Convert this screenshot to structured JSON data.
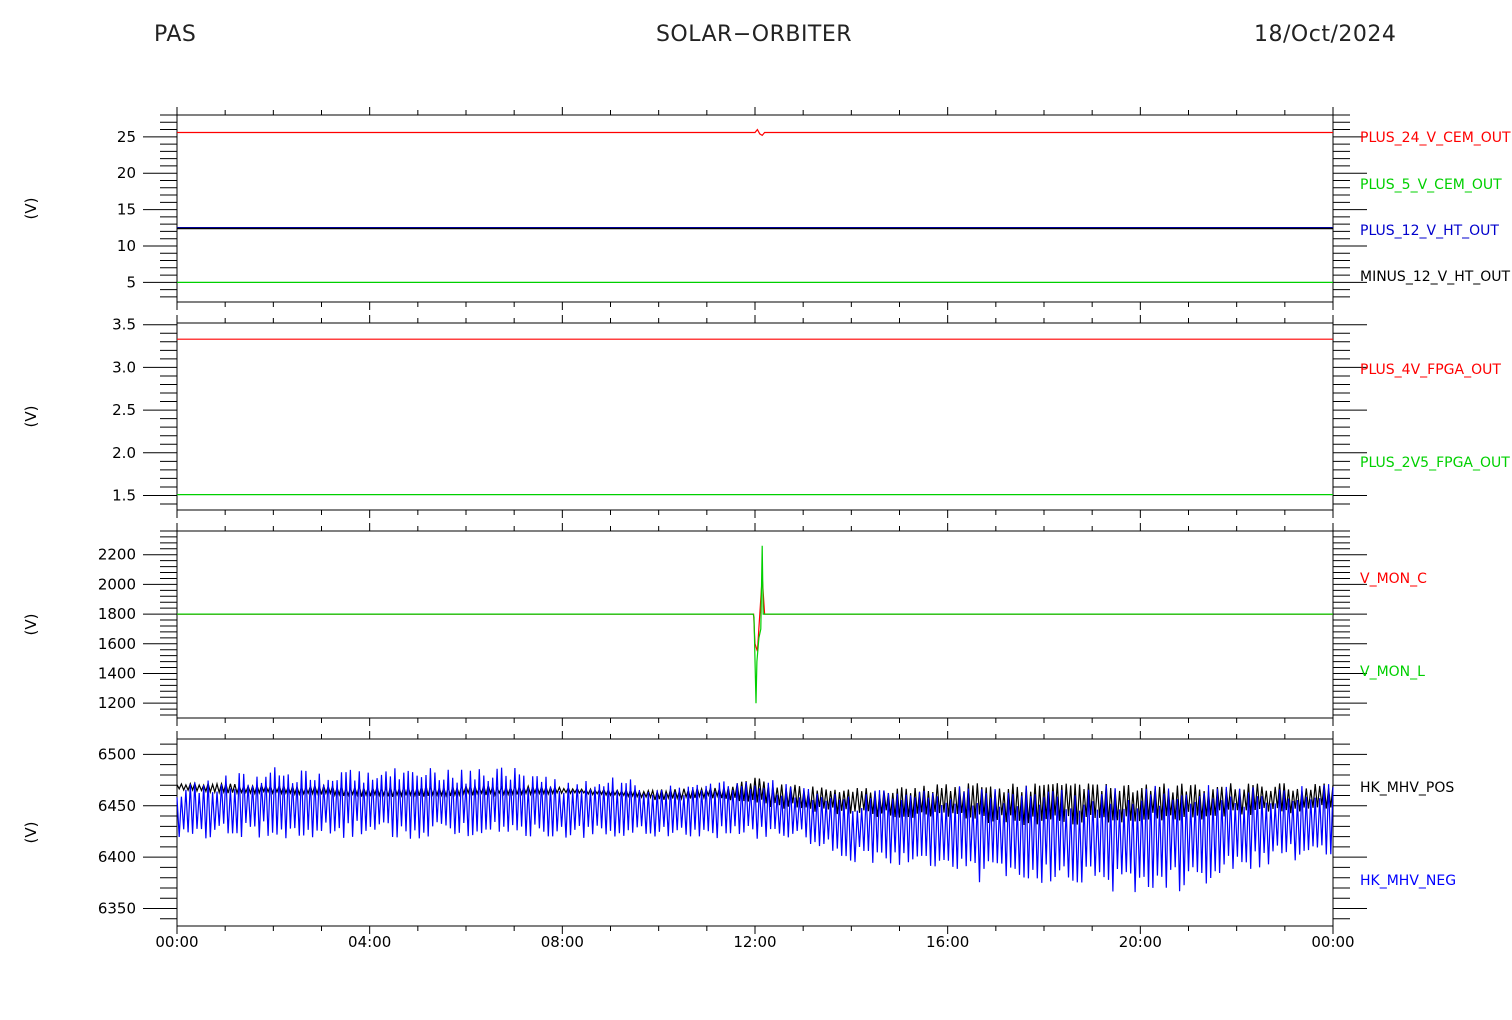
{
  "header": {
    "left": "PAS",
    "center": "SOLAR−ORBITER",
    "right": "18/Oct/2024"
  },
  "chart_data": [
    {
      "type": "line",
      "ylabel": "(V)",
      "ylim": [
        2.3,
        28.0
      ],
      "yticks": [
        5,
        10,
        15,
        20,
        25
      ],
      "ytick_labels": [
        "5",
        "10",
        "15",
        "20",
        "25"
      ],
      "x_hours": [
        0,
        24
      ],
      "series": [
        {
          "name": "PLUS_24_V_CEM_OUT",
          "color": "#ff0000",
          "x": [
            0,
            12.0,
            12.05,
            12.1,
            12.15,
            12.2,
            24
          ],
          "y": [
            25.6,
            25.6,
            26.0,
            25.4,
            25.2,
            25.6,
            25.6
          ]
        },
        {
          "name": "PLUS_5_V_CEM_OUT",
          "color": "#00d000",
          "x": [
            0,
            24
          ],
          "y": [
            5.0,
            5.0
          ]
        },
        {
          "name": "PLUS_12_V_HT_OUT",
          "color": "#0000cc",
          "x": [
            0,
            24
          ],
          "y": [
            12.5,
            12.5
          ]
        },
        {
          "name": "MINUS_12_V_HT_OUT",
          "color": "#000000",
          "x": [
            0,
            24
          ],
          "y": [
            12.4,
            12.4
          ]
        }
      ]
    },
    {
      "type": "line",
      "ylabel": "(V)",
      "ylim": [
        1.33,
        3.52
      ],
      "yticks": [
        1.5,
        2.0,
        2.5,
        3.0,
        3.5
      ],
      "ytick_labels": [
        "1.5",
        "2.0",
        "2.5",
        "3.0",
        "3.5"
      ],
      "x_hours": [
        0,
        24
      ],
      "series": [
        {
          "name": "PLUS_4V_FPGA_OUT",
          "color": "#ff0000",
          "x": [
            0,
            24
          ],
          "y": [
            3.33,
            3.33
          ]
        },
        {
          "name": "PLUS_2V5_FPGA_OUT",
          "color": "#00d000",
          "x": [
            0,
            24
          ],
          "y": [
            1.51,
            1.51
          ]
        }
      ]
    },
    {
      "type": "line",
      "ylabel": "(V)",
      "ylim": [
        1100,
        2360
      ],
      "yticks": [
        1200,
        1400,
        1600,
        1800,
        2000,
        2200
      ],
      "ytick_labels": [
        "1200",
        "1400",
        "1600",
        "1800",
        "2000",
        "2200"
      ],
      "x_hours": [
        0,
        24
      ],
      "series": [
        {
          "name": "V_MON_C",
          "color": "#ff0000",
          "x": [
            0,
            11.97,
            12.0,
            12.05,
            12.1,
            12.15,
            12.2,
            24
          ],
          "y": [
            1800,
            1800,
            1600,
            1550,
            1800,
            2050,
            1800,
            1800
          ]
        },
        {
          "name": "V_MON_L",
          "color": "#00d000",
          "x": [
            0,
            11.96,
            11.98,
            12.02,
            12.04,
            12.08,
            12.12,
            12.15,
            12.17,
            12.2,
            24
          ],
          "y": [
            1800,
            1800,
            1780,
            1200,
            1480,
            1640,
            1700,
            2260,
            1800,
            1800,
            1800
          ]
        }
      ]
    },
    {
      "type": "line",
      "ylabel": "(V)",
      "ylim": [
        6333,
        6515
      ],
      "yticks": [
        6350,
        6400,
        6450,
        6500
      ],
      "ytick_labels": [
        "6350",
        "6400",
        "6450",
        "6500"
      ],
      "xtick_labels": [
        "00:00",
        "04:00",
        "08:00",
        "12:00",
        "16:00",
        "20:00",
        "00:00"
      ],
      "x_hours": [
        0,
        24
      ],
      "series": [
        {
          "name": "HK_MHV_POS",
          "color": "#000000"
        },
        {
          "name": "HK_MHV_NEG",
          "color": "#0000ff"
        }
      ],
      "envelope_hours": [
        0,
        1,
        2,
        3,
        4,
        5,
        6,
        7,
        8,
        9,
        10,
        11,
        12,
        13,
        14,
        15,
        16,
        17,
        18,
        19,
        20,
        21,
        22,
        23,
        24
      ],
      "pos_low": [
        6465,
        6462,
        6462,
        6460,
        6458,
        6458,
        6460,
        6460,
        6462,
        6460,
        6455,
        6458,
        6450,
        6445,
        6440,
        6438,
        6435,
        6432,
        6430,
        6432,
        6435,
        6435,
        6440,
        6440,
        6445
      ],
      "pos_high": [
        6472,
        6472,
        6470,
        6470,
        6470,
        6470,
        6470,
        6470,
        6468,
        6466,
        6466,
        6468,
        6478,
        6470,
        6468,
        6468,
        6472,
        6472,
        6472,
        6472,
        6472,
        6472,
        6472,
        6472,
        6472
      ],
      "neg_low": [
        6418,
        6418,
        6418,
        6418,
        6418,
        6418,
        6418,
        6418,
        6418,
        6418,
        6418,
        6418,
        6418,
        6415,
        6395,
        6390,
        6380,
        6370,
        6370,
        6365,
        6360,
        6365,
        6385,
        6395,
        6400
      ],
      "neg_high": [
        6470,
        6480,
        6488,
        6488,
        6488,
        6488,
        6488,
        6488,
        6475,
        6480,
        6470,
        6475,
        6478,
        6470,
        6460,
        6470,
        6472,
        6472,
        6470,
        6472,
        6470,
        6472,
        6468,
        6468,
        6472
      ]
    }
  ]
}
